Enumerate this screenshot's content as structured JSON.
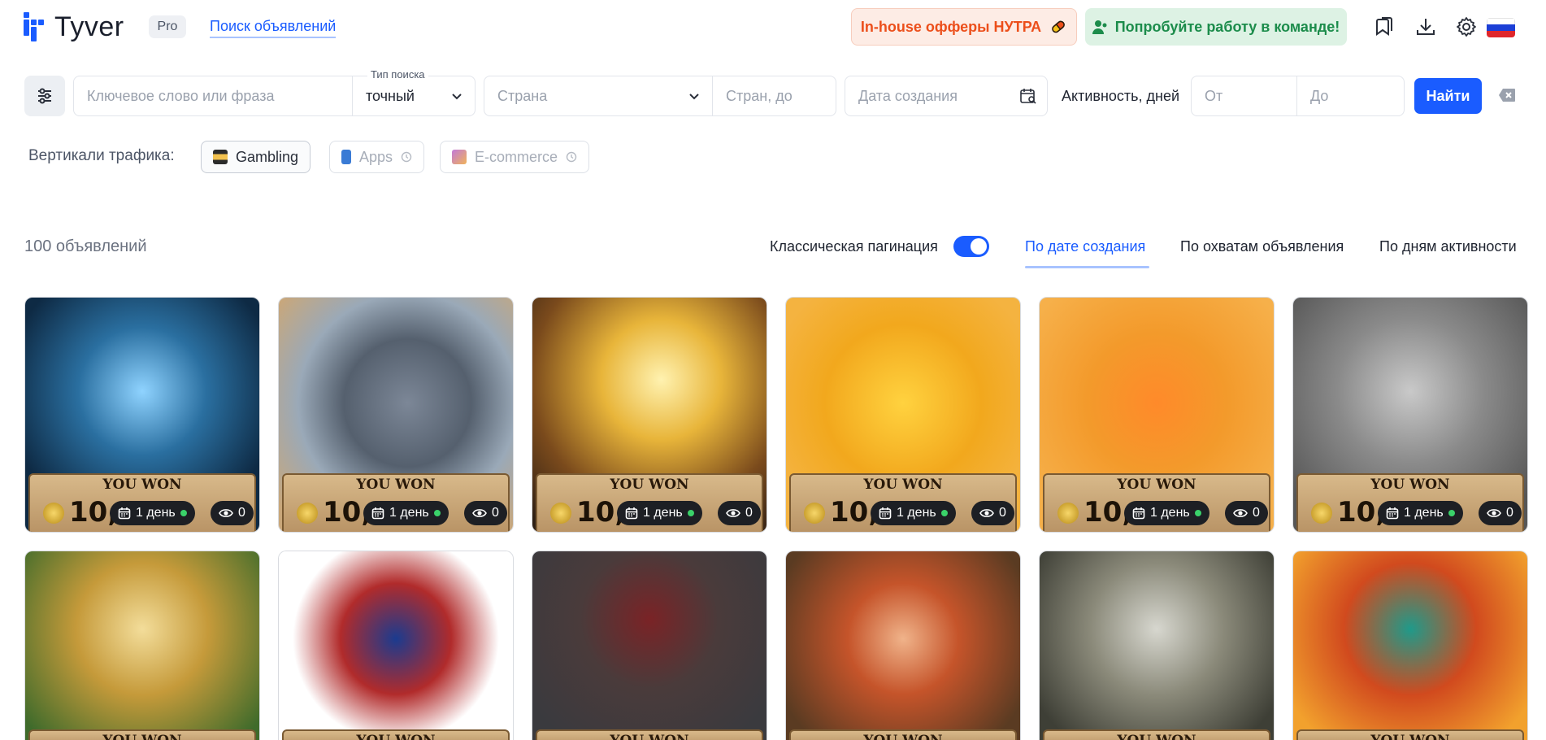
{
  "header": {
    "logo_text": "Tyver",
    "plan_badge": "Pro",
    "nav_link": "Поиск объявлений",
    "promo_offers": "In-house офферы НУТРА",
    "promo_team": "Попробуйте работу в команде!",
    "icons": [
      "bookmarks-icon",
      "download-icon",
      "settings-icon",
      "russia-flag-icon"
    ]
  },
  "search": {
    "keyword_placeholder": "Ключевое слово или фраза",
    "type_label": "Тип поиска",
    "type_value": "точный",
    "country_placeholder": "Страна",
    "country_to_placeholder": "Стран, до",
    "date_placeholder": "Дата создания",
    "activity_label": "Активность, дней",
    "from_placeholder": "От",
    "to_placeholder": "До",
    "find_label": "Найти"
  },
  "verticals": {
    "label": "Вертикали трафика:",
    "items": [
      {
        "label": "Gambling",
        "active": true
      },
      {
        "label": "Apps",
        "active": false
      },
      {
        "label": "E-commerce",
        "active": false
      }
    ]
  },
  "results": {
    "count": "100 объявлений",
    "classic_pagination": "Классическая пагинация",
    "pagination_enabled": true,
    "sort_options": [
      "По дате создания",
      "По охватам объявления",
      "По дням активности"
    ],
    "active_sort": "По дате создания"
  },
  "cards": [
    {
      "banner": "YOU WON",
      "amount": "10,",
      "days": "1 день",
      "views": "0",
      "theme": "ice-woman"
    },
    {
      "banner": "YOU WON",
      "amount": "10,",
      "days": "1 день",
      "views": "0",
      "theme": "rhino"
    },
    {
      "banner": "YOU WON",
      "amount": "10,",
      "days": "1 день",
      "views": "0",
      "theme": "lightning-warrior"
    },
    {
      "banner": "YOU WON",
      "amount": "10,",
      "days": "1 день",
      "views": "0",
      "theme": "robot-slot"
    },
    {
      "banner": "YOU WON",
      "amount": "10,",
      "days": "1 день",
      "views": "0",
      "theme": "orange-slot-machine"
    },
    {
      "banner": "YOU WON",
      "amount": "10,",
      "days": "1 день",
      "views": "0",
      "theme": "stone-king"
    },
    {
      "banner": "YOU WON",
      "theme": "clover-goddess"
    },
    {
      "banner": "YOU WON",
      "theme": "snow-white"
    },
    {
      "banner": "YOU WON",
      "theme": "demon-wolves"
    },
    {
      "banner": "YOU WON",
      "theme": "elf-tavern"
    },
    {
      "banner": "YOU WON",
      "theme": "silver-knight"
    },
    {
      "banner": "YOU WON",
      "theme": "mariachi"
    }
  ],
  "colors": {
    "accent": "#1a5cff",
    "promo_orange": "#ec4f1b",
    "promo_green": "#1c8c4b"
  }
}
